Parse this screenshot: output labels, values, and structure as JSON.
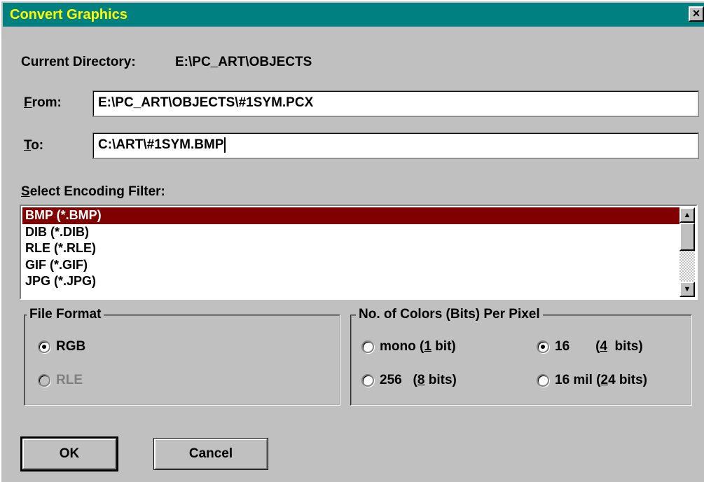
{
  "window": {
    "title": "Convert Graphics",
    "close_glyph": "×"
  },
  "current_directory": {
    "label": "Current Directory:",
    "value": "E:\\PC_ART\\OBJECTS"
  },
  "from": {
    "label_mnemonic": "F",
    "label_rest": "rom:",
    "value": "E:\\PC_ART\\OBJECTS\\#1SYM.PCX"
  },
  "to": {
    "label_mnemonic": "T",
    "label_rest": "o:",
    "value": "C:\\ART\\#1SYM.BMP"
  },
  "encoding": {
    "label_mnemonic": "S",
    "label_rest": "elect Encoding Filter:",
    "items": [
      {
        "label": "BMP (*.BMP)",
        "selected": true
      },
      {
        "label": "DIB (*.DIB)",
        "selected": false
      },
      {
        "label": "RLE (*.RLE)",
        "selected": false
      },
      {
        "label": "GIF (*.GIF)",
        "selected": false
      },
      {
        "label": "JPG (*.JPG)",
        "selected": false
      }
    ],
    "scroll_up_icon": "scroll-up-arrow",
    "scroll_down_icon": "scroll-down-arrow"
  },
  "file_format": {
    "title": "File Format",
    "options": [
      {
        "label": "RGB",
        "checked": true,
        "enabled": true
      },
      {
        "label": "RLE",
        "checked": false,
        "enabled": false
      }
    ]
  },
  "colors": {
    "title": "No. of Colors (Bits) Per Pixel",
    "mono": {
      "a": "mono (",
      "m": "1",
      "b": " bit)",
      "checked": false
    },
    "c256": {
      "a": "256   (",
      "m": "8",
      "b": " bits)",
      "checked": false
    },
    "c16": {
      "a": "16       (",
      "m": "4",
      "b": "  bits)",
      "checked": true
    },
    "c16mil": {
      "a": "16 mil (",
      "m": "2",
      "b": "4 bits)",
      "checked": false
    }
  },
  "buttons": {
    "ok": "OK",
    "cancel": "Cancel"
  },
  "colors_theme": {
    "titlebar": "#008080",
    "title_text": "#ffff00",
    "selection": "#800000",
    "face": "#c0c0c0"
  }
}
